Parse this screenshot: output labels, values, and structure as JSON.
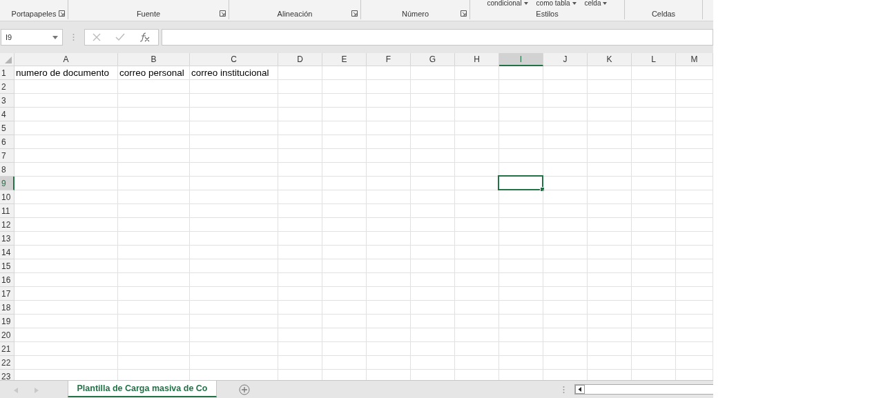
{
  "ribbon": {
    "groups": [
      {
        "label": "Portapapeles",
        "launcher": true
      },
      {
        "label": "Fuente",
        "launcher": true
      },
      {
        "label": "Alineación",
        "launcher": true
      },
      {
        "label": "Número",
        "launcher": true
      },
      {
        "label": "Estilos",
        "launcher": false,
        "buttons": [
          "condicional",
          "como tabla",
          "celda"
        ]
      },
      {
        "label": "Celdas",
        "launcher": false
      }
    ]
  },
  "name_box": {
    "value": "I9"
  },
  "columns": [
    {
      "label": "A",
      "selected": false
    },
    {
      "label": "B",
      "selected": false
    },
    {
      "label": "C",
      "selected": false
    },
    {
      "label": "D",
      "selected": false
    },
    {
      "label": "E",
      "selected": false
    },
    {
      "label": "F",
      "selected": false
    },
    {
      "label": "G",
      "selected": false
    },
    {
      "label": "H",
      "selected": false
    },
    {
      "label": "I",
      "selected": true
    },
    {
      "label": "J",
      "selected": false
    },
    {
      "label": "K",
      "selected": false
    },
    {
      "label": "L",
      "selected": false
    },
    {
      "label": "M",
      "selected": false
    }
  ],
  "rows": [
    {
      "label": "1",
      "selected": false,
      "cells": [
        "numero de documento",
        "correo personal",
        "correo institucional"
      ]
    },
    {
      "label": "2",
      "selected": false
    },
    {
      "label": "3",
      "selected": false
    },
    {
      "label": "4",
      "selected": false
    },
    {
      "label": "5",
      "selected": false
    },
    {
      "label": "6",
      "selected": false
    },
    {
      "label": "7",
      "selected": false
    },
    {
      "label": "8",
      "selected": false
    },
    {
      "label": "9",
      "selected": true
    },
    {
      "label": "10",
      "selected": false
    },
    {
      "label": "11",
      "selected": false
    },
    {
      "label": "12",
      "selected": false
    },
    {
      "label": "13",
      "selected": false
    },
    {
      "label": "14",
      "selected": false
    },
    {
      "label": "15",
      "selected": false
    },
    {
      "label": "16",
      "selected": false
    },
    {
      "label": "17",
      "selected": false
    },
    {
      "label": "18",
      "selected": false
    },
    {
      "label": "19",
      "selected": false
    },
    {
      "label": "20",
      "selected": false
    },
    {
      "label": "21",
      "selected": false
    },
    {
      "label": "22",
      "selected": false
    },
    {
      "label": "23",
      "selected": false
    }
  ],
  "sheet_tabs": [
    {
      "label": "Plantilla de Carga masiva de Co",
      "selected": true
    }
  ]
}
